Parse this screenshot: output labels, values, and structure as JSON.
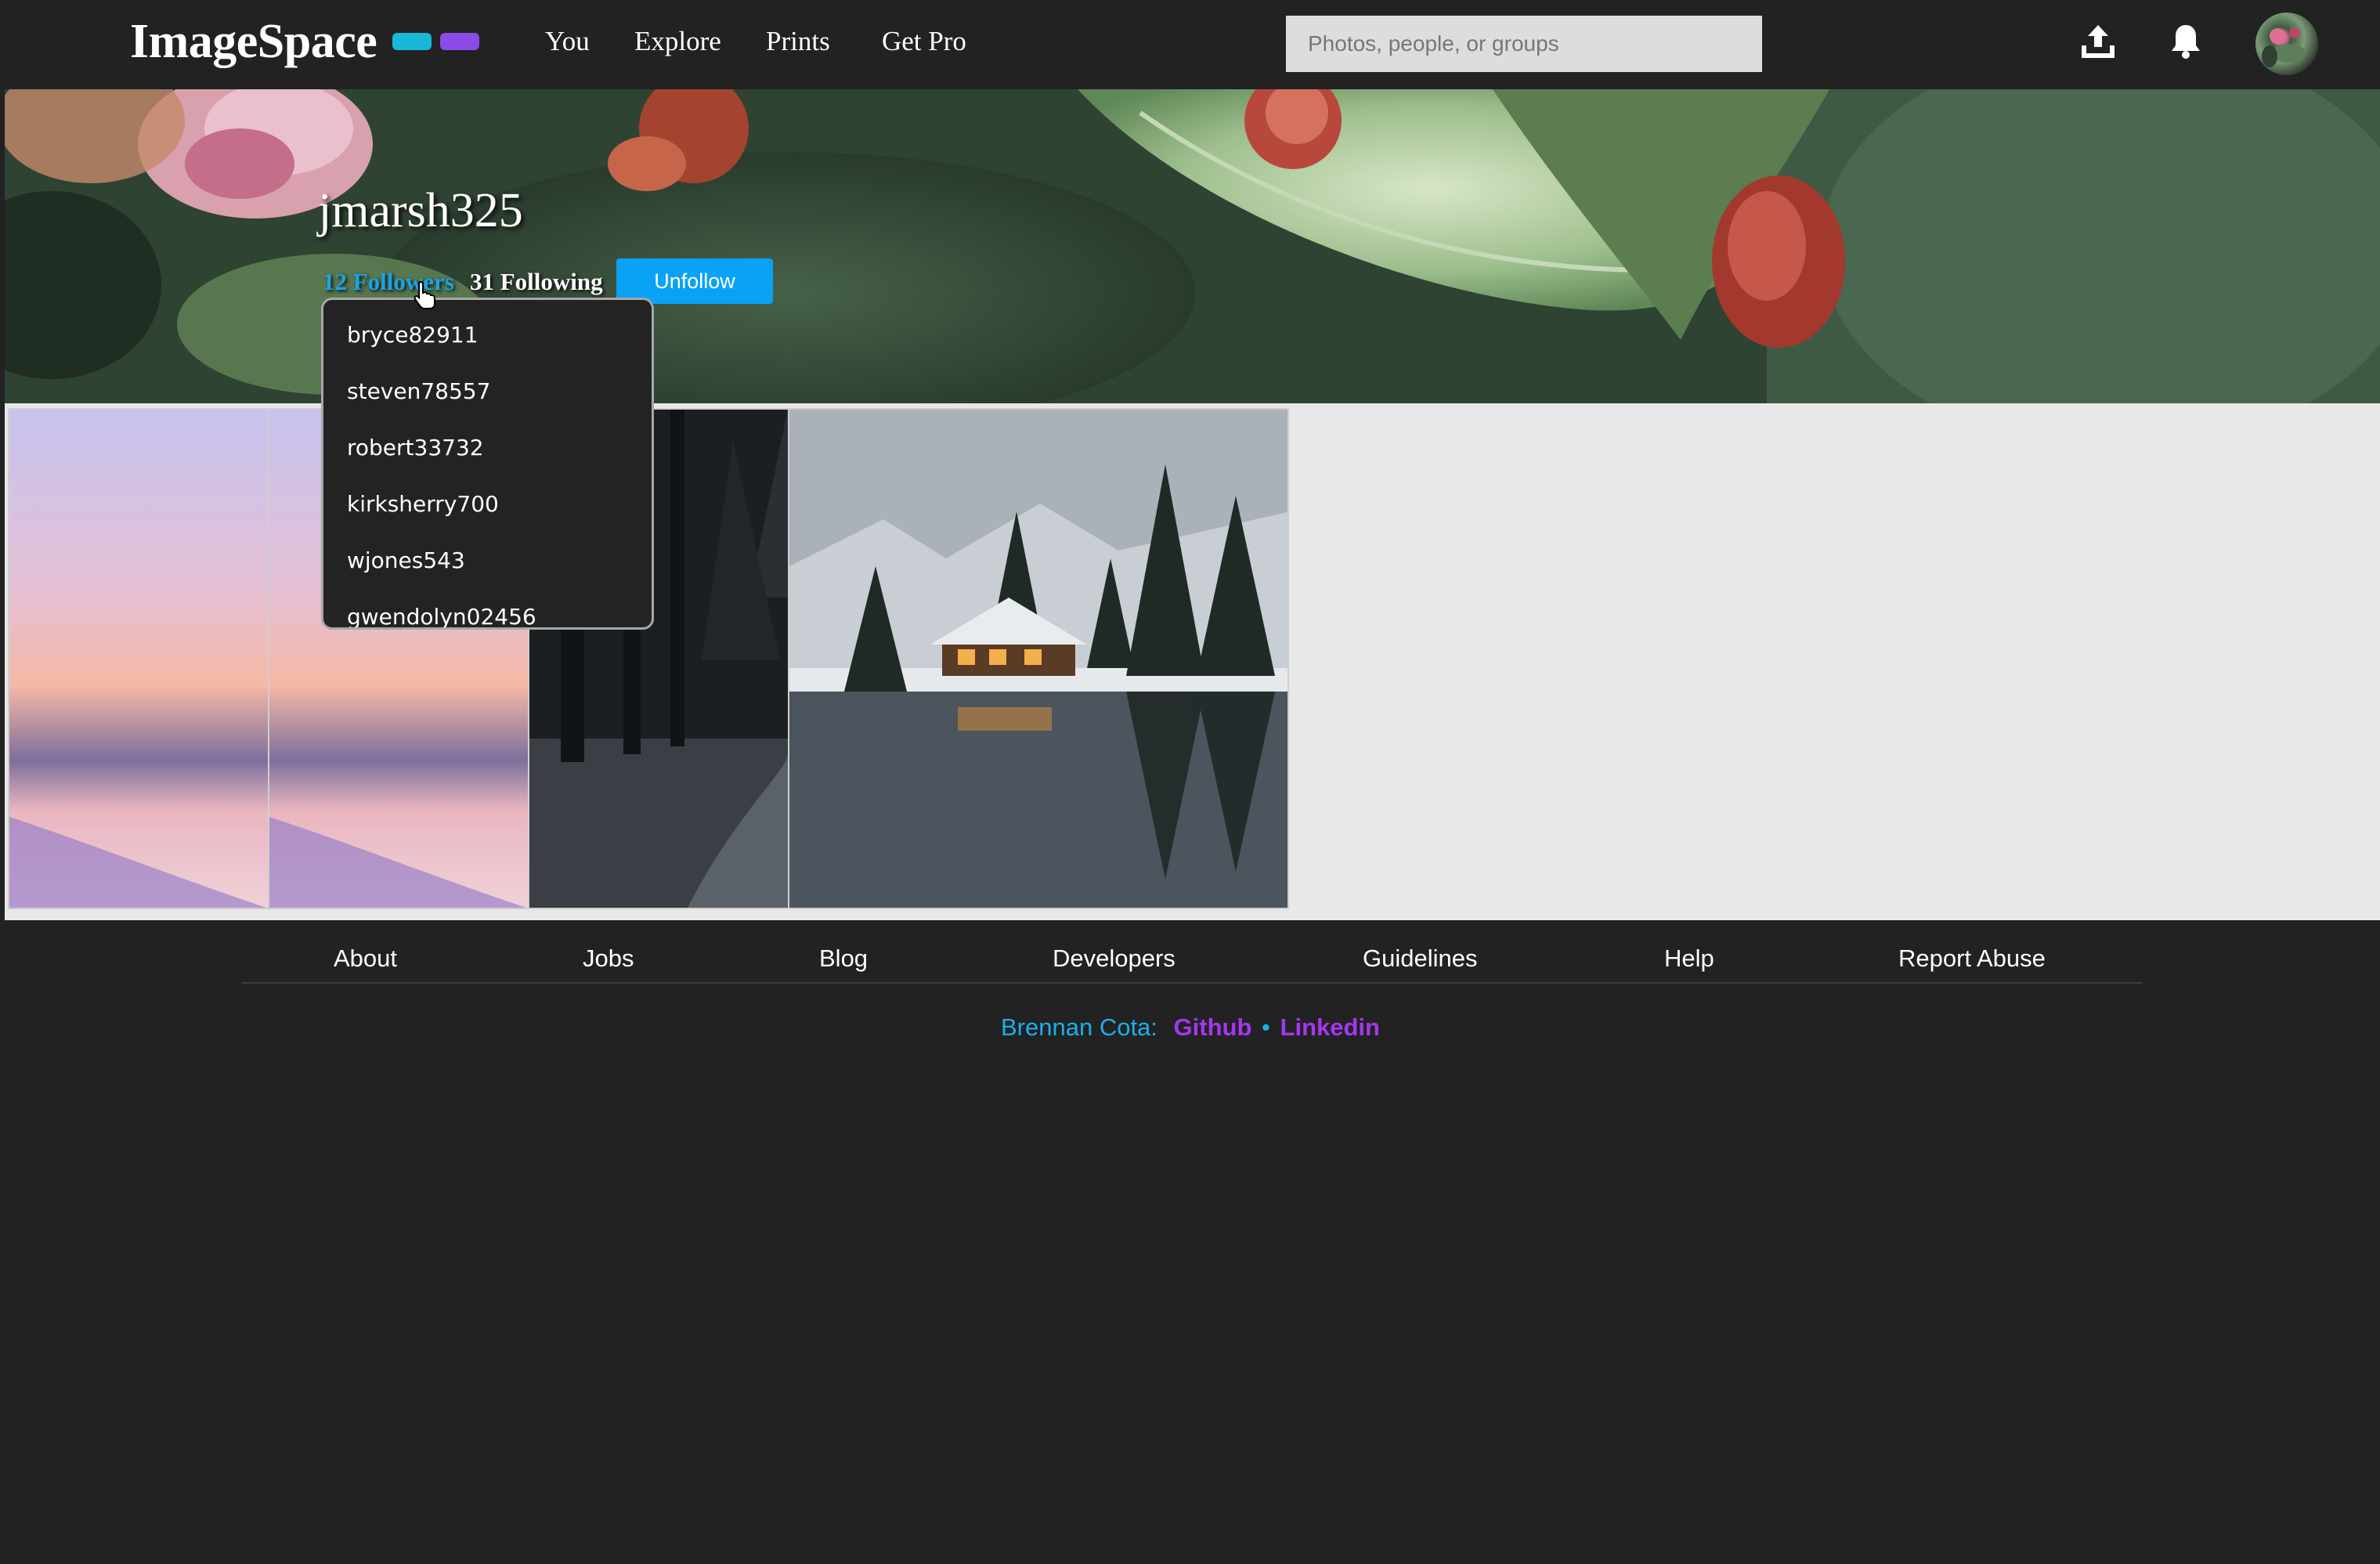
{
  "colors": {
    "accent_blue": "#0aa2f5",
    "logo_cyan": "#19b8d8",
    "logo_purple": "#8a4be6",
    "footer_purple": "#a536f0",
    "background": "#222222"
  },
  "header": {
    "logo": "ImageSpace",
    "nav": [
      "You",
      "Explore",
      "Prints",
      "Get Pro"
    ],
    "search_placeholder": "Photos, people, or groups",
    "icons": [
      "upload-icon",
      "bell-icon",
      "avatar"
    ]
  },
  "profile": {
    "username": "jmarsh325",
    "followers_label": "12 Followers",
    "following_label": "31 Following",
    "unfollow_label": "Unfollow"
  },
  "followers_dropdown": {
    "items": [
      "bryce82911",
      "steven78557",
      "robert33732",
      "kirksherry700",
      "wjones543",
      "gwendolyn02456"
    ]
  },
  "gallery": {
    "photos": [
      "pastel-sunset-lake",
      "pastel-sunset-lake",
      "dark-snowy-forest",
      "snowy-lake-cabin"
    ]
  },
  "footer": {
    "links": [
      "About",
      "Jobs",
      "Blog",
      "Developers",
      "Guidelines",
      "Help",
      "Report Abuse"
    ],
    "credit_name": "Brennan Cota:",
    "credit_github": "Github",
    "credit_separator": "•",
    "credit_linkedin": "Linkedin"
  }
}
